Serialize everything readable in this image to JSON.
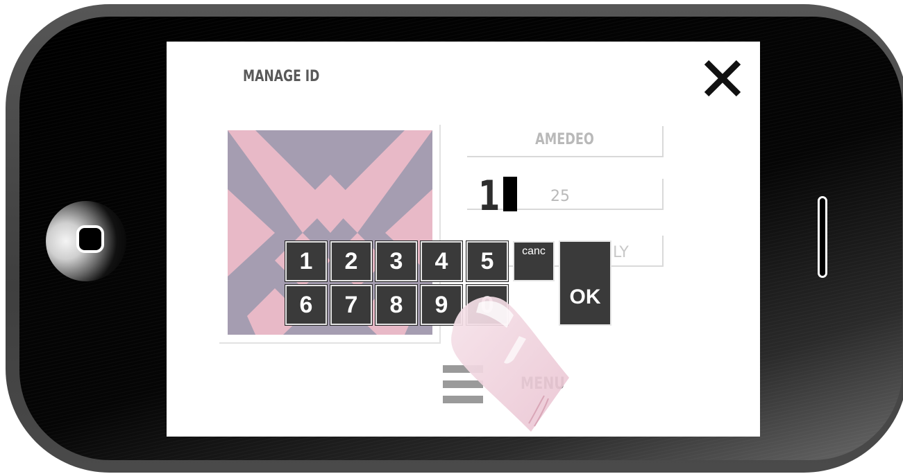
{
  "screen": {
    "title": "MANAGE ID",
    "close_icon": "close-icon",
    "profile": {
      "name": "AMEDEO",
      "entered_digit": "1",
      "age": "25",
      "language_fragment": "LY"
    },
    "keypad": {
      "keys": [
        "1",
        "2",
        "3",
        "4",
        "5",
        "6",
        "7",
        "8",
        "9",
        "0"
      ],
      "cancel_label": "canc",
      "ok_label": "OK"
    },
    "menu": {
      "label": "MENU",
      "icon": "hamburger-icon"
    }
  },
  "colors": {
    "pattern_pink": "#e8b9c7",
    "pattern_purple": "#a59db1",
    "key_bg": "#3a3a3a",
    "phone_body": "#4a4a4a"
  }
}
